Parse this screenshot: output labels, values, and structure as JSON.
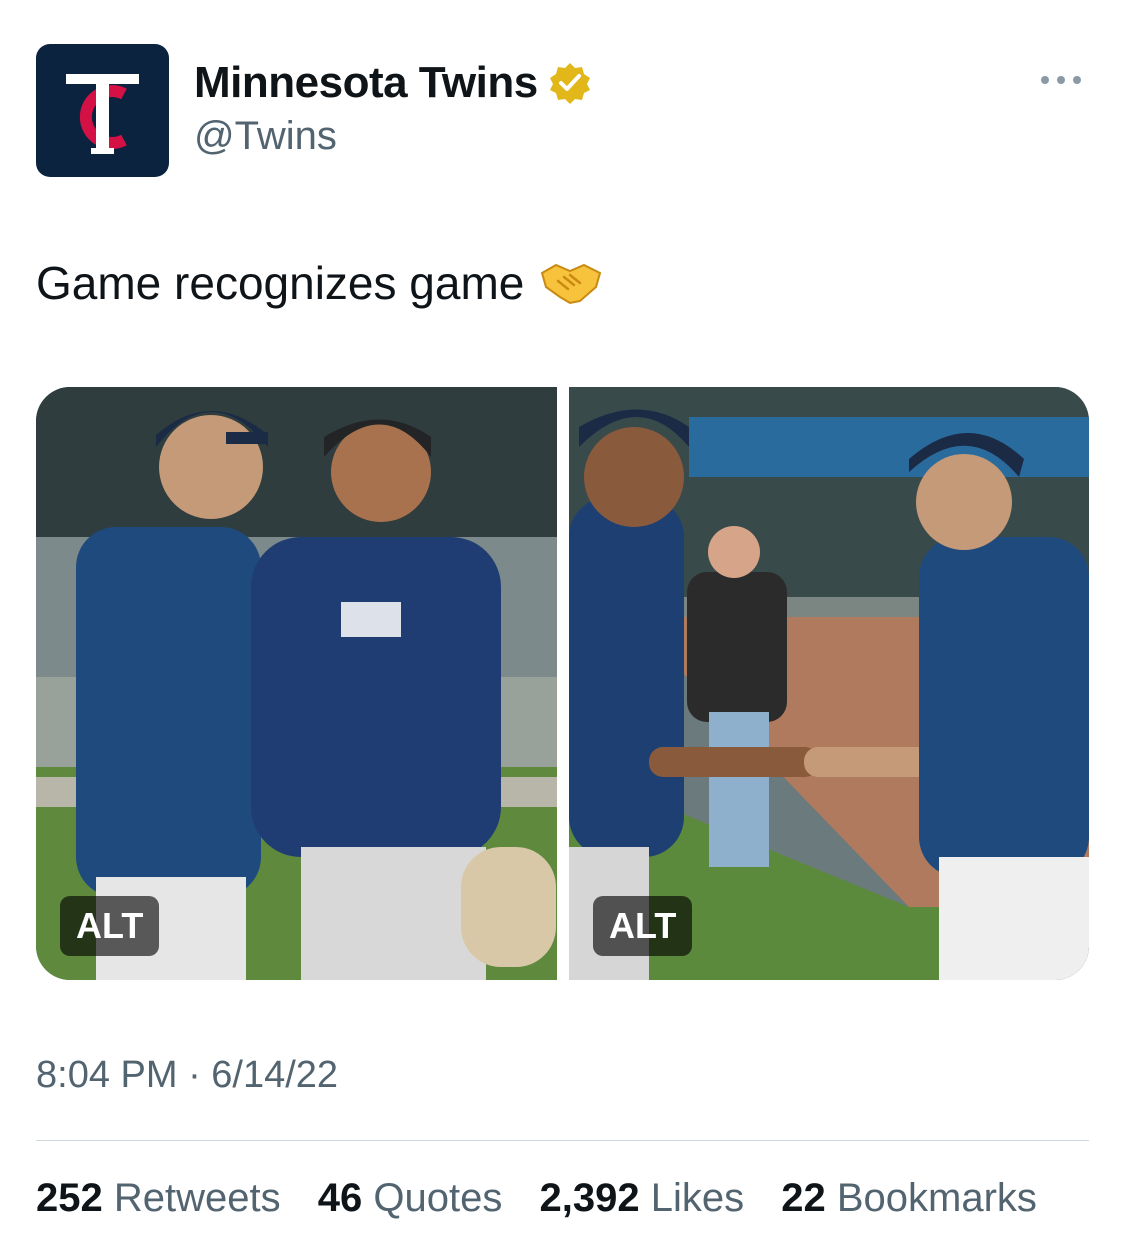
{
  "tweet": {
    "author": {
      "display_name": "Minnesota Twins",
      "handle": "@Twins",
      "verified": true,
      "avatar_icon": "twins-tc-logo",
      "avatar_bg": "#0c2340",
      "avatar_accent": "#d31145"
    },
    "text": "Game recognizes game",
    "emoji": "handshake-emoji",
    "media": [
      {
        "alt_badge": "ALT",
        "subject": "photo-two-players-posing"
      },
      {
        "alt_badge": "ALT",
        "subject": "photo-players-handshake"
      }
    ],
    "timestamp": "8:04 PM · 6/14/22",
    "stats": {
      "retweets": {
        "count": "252",
        "label": "Retweets"
      },
      "quotes": {
        "count": "46",
        "label": "Quotes"
      },
      "likes": {
        "count": "2,392",
        "label": "Likes"
      },
      "bookmarks": {
        "count": "22",
        "label": "Bookmarks"
      }
    }
  },
  "colors": {
    "text_primary": "#0f1419",
    "text_secondary": "#536471",
    "verified_gold": "#e2b719",
    "divider": "#cfd9de"
  }
}
